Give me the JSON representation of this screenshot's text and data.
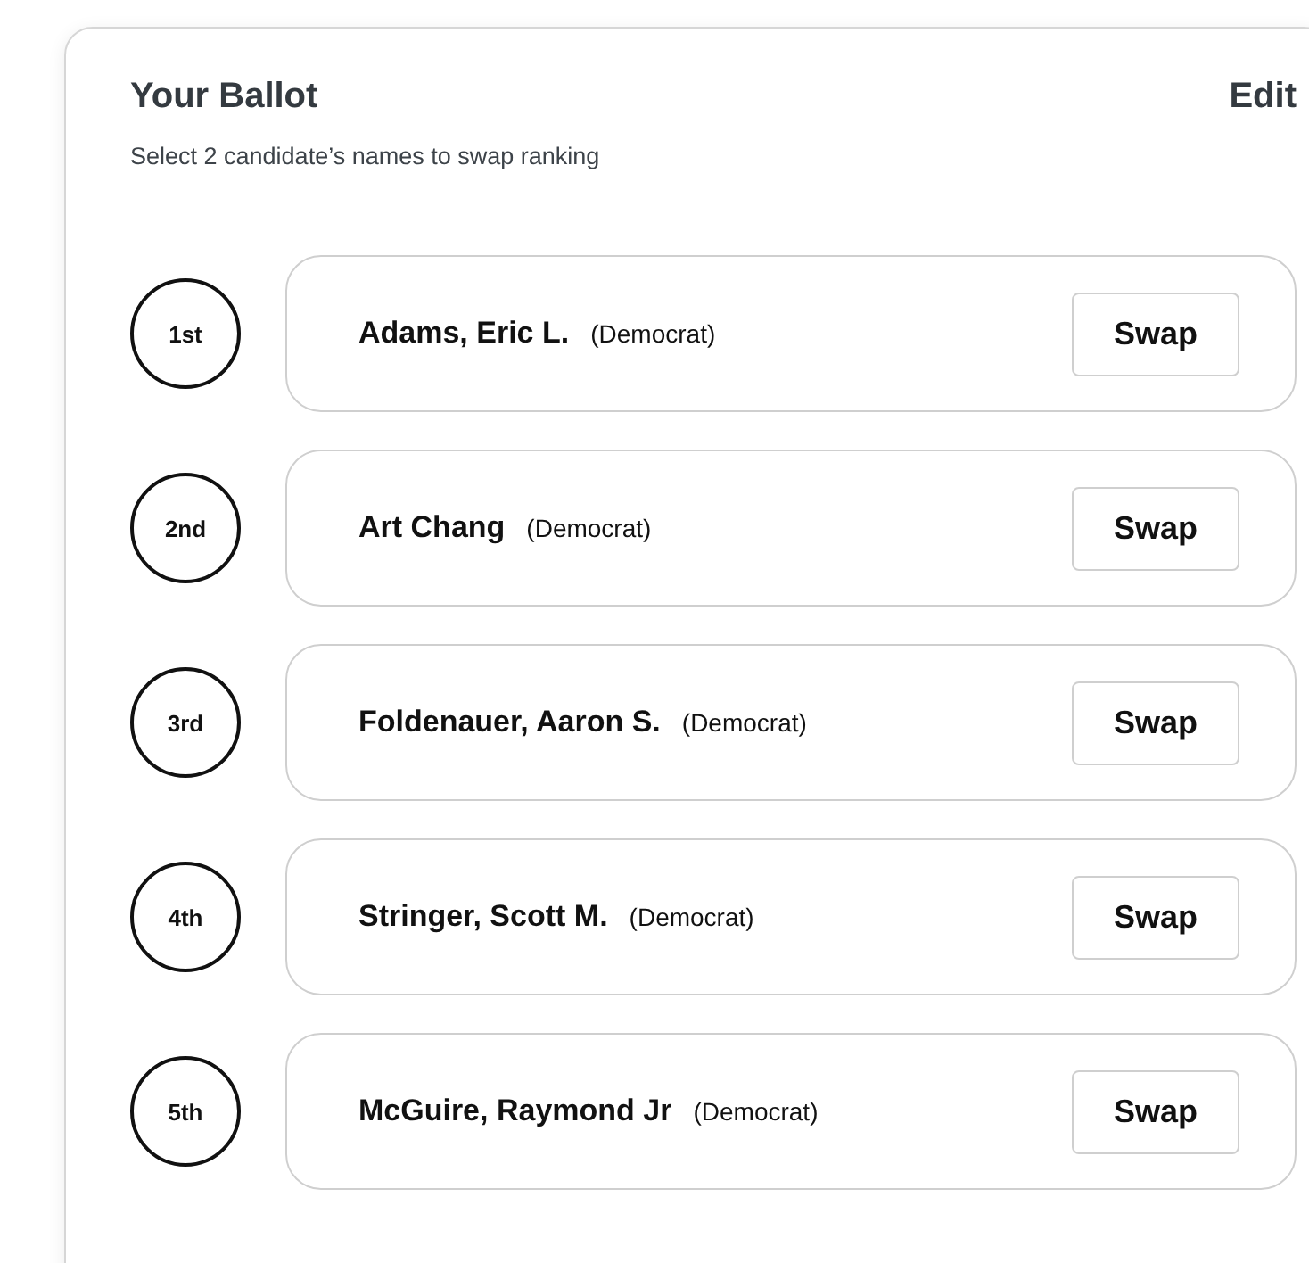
{
  "header": {
    "title": "Your Ballot",
    "edit_link": "Edit",
    "instructions": "Select 2 candidate’s names to swap ranking"
  },
  "candidates": [
    {
      "rank": "1st",
      "name": "Adams, Eric L.",
      "party": "(Democrat)",
      "button": "Swap"
    },
    {
      "rank": "2nd",
      "name": "Art Chang",
      "party": "(Democrat)",
      "button": "Swap"
    },
    {
      "rank": "3rd",
      "name": "Foldenauer, Aaron S.",
      "party": "(Democrat)",
      "button": "Swap"
    },
    {
      "rank": "4th",
      "name": "Stringer, Scott M.",
      "party": "(Democrat)",
      "button": "Swap"
    },
    {
      "rank": "5th",
      "name": "McGuire, Raymond Jr",
      "party": "(Democrat)",
      "button": "Swap"
    }
  ]
}
